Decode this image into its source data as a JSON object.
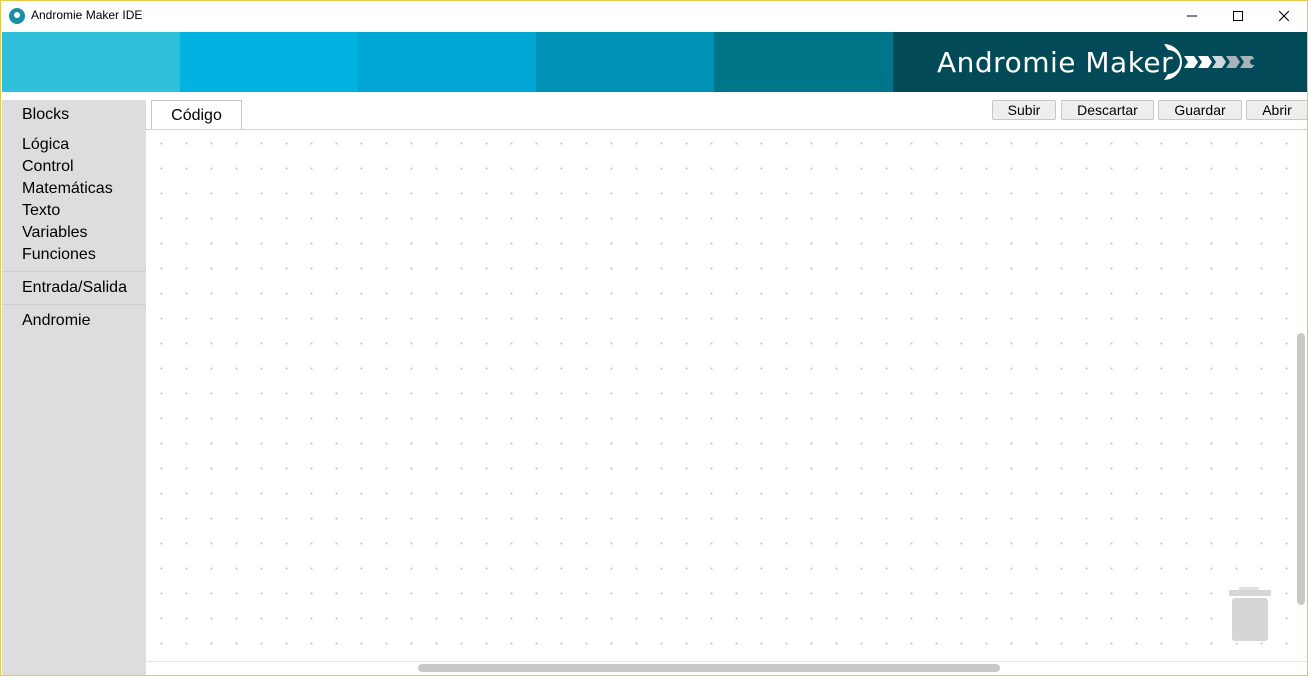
{
  "window": {
    "title": "Andromie Maker IDE"
  },
  "banner": {
    "brand_text": "Andromie Maker",
    "stripe_colors": [
      "#31c0dc",
      "#00b3e0",
      "#00a7d4",
      "#0092b5",
      "#00758a"
    ],
    "brand_color": "#034a58"
  },
  "sidebar": {
    "header": "Blocks",
    "groups": [
      {
        "items": [
          "Lógica",
          "Control",
          "Matemáticas",
          "Texto",
          "Variables",
          "Funciones"
        ]
      },
      {
        "items": [
          "Entrada/Salida"
        ]
      },
      {
        "items": [
          "Andromie"
        ]
      }
    ]
  },
  "tabs": [
    {
      "label": "Código",
      "active": true
    }
  ],
  "toolbar": {
    "upload_label": "Subir",
    "discard_label": "Descartar",
    "save_label": "Guardar",
    "open_label": "Abrir"
  },
  "icons": {
    "app": "app-icon",
    "minimize": "minimize-icon",
    "maximize": "maximize-icon",
    "close": "close-icon",
    "logo": "andromie-logo-icon",
    "trash": "trash-icon"
  }
}
